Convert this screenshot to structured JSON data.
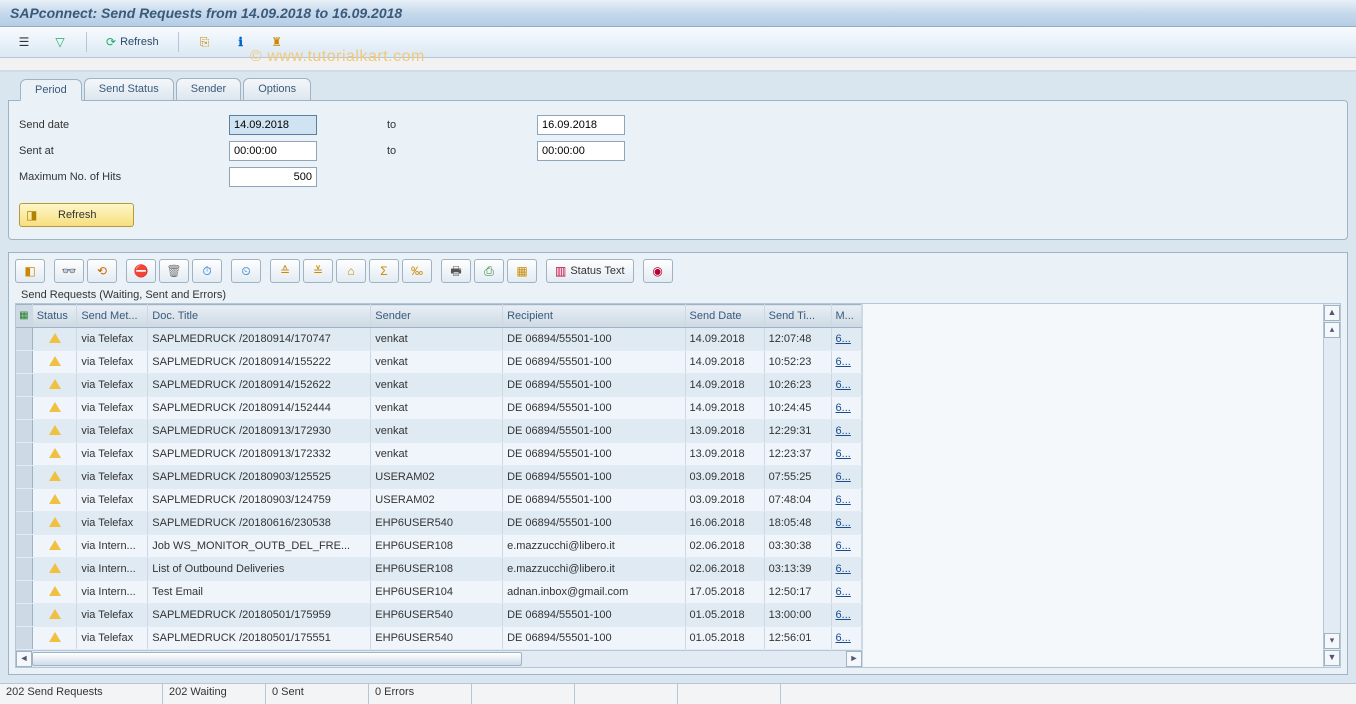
{
  "title": "SAPconnect: Send Requests from 14.09.2018 to 16.09.2018",
  "watermark": "©   www.tutorialkart.com",
  "toolbar": {
    "refresh_label": "Refresh"
  },
  "tabs": [
    "Period",
    "Send Status",
    "Sender",
    "Options"
  ],
  "form": {
    "send_date_label": "Send date",
    "send_date_from": "14.09.2018",
    "to_label": "to",
    "send_date_to": "16.09.2018",
    "sent_at_label": "Sent at",
    "sent_at_from": "00:00:00",
    "sent_at_to": "00:00:00",
    "max_hits_label": "Maximum No. of Hits",
    "max_hits": "500",
    "refresh_btn": "Refresh"
  },
  "grid_toolbar": {
    "status_text_label": "Status Text"
  },
  "grid": {
    "subtitle": "Send Requests (Waiting, Sent and Errors)",
    "columns": {
      "status": "Status",
      "method": "Send Met...",
      "title": "Doc. Title",
      "sender": "Sender",
      "recipient": "Recipient",
      "date": "Send Date",
      "time": "Send Ti...",
      "msg": "M..."
    },
    "rows": [
      {
        "method": "via Telefax",
        "title": "SAPLMEDRUCK /20180914/170747",
        "sender": "venkat",
        "recipient": "DE 06894/55501-100",
        "date": "14.09.2018",
        "time": "12:07:48",
        "msg": "6..."
      },
      {
        "method": "via Telefax",
        "title": "SAPLMEDRUCK /20180914/155222",
        "sender": "venkat",
        "recipient": "DE 06894/55501-100",
        "date": "14.09.2018",
        "time": "10:52:23",
        "msg": "6..."
      },
      {
        "method": "via Telefax",
        "title": "SAPLMEDRUCK /20180914/152622",
        "sender": "venkat",
        "recipient": "DE 06894/55501-100",
        "date": "14.09.2018",
        "time": "10:26:23",
        "msg": "6..."
      },
      {
        "method": "via Telefax",
        "title": "SAPLMEDRUCK /20180914/152444",
        "sender": "venkat",
        "recipient": "DE 06894/55501-100",
        "date": "14.09.2018",
        "time": "10:24:45",
        "msg": "6..."
      },
      {
        "method": "via Telefax",
        "title": "SAPLMEDRUCK /20180913/172930",
        "sender": "venkat",
        "recipient": "DE 06894/55501-100",
        "date": "13.09.2018",
        "time": "12:29:31",
        "msg": "6..."
      },
      {
        "method": "via Telefax",
        "title": "SAPLMEDRUCK /20180913/172332",
        "sender": "venkat",
        "recipient": "DE 06894/55501-100",
        "date": "13.09.2018",
        "time": "12:23:37",
        "msg": "6..."
      },
      {
        "method": "via Telefax",
        "title": "SAPLMEDRUCK /20180903/125525",
        "sender": "USERAM02",
        "recipient": "DE 06894/55501-100",
        "date": "03.09.2018",
        "time": "07:55:25",
        "msg": "6..."
      },
      {
        "method": "via Telefax",
        "title": "SAPLMEDRUCK /20180903/124759",
        "sender": "USERAM02",
        "recipient": "DE 06894/55501-100",
        "date": "03.09.2018",
        "time": "07:48:04",
        "msg": "6..."
      },
      {
        "method": "via Telefax",
        "title": "SAPLMEDRUCK /20180616/230538",
        "sender": "EHP6USER540",
        "recipient": "DE 06894/55501-100",
        "date": "16.06.2018",
        "time": "18:05:48",
        "msg": "6..."
      },
      {
        "method": "via Intern...",
        "title": "Job WS_MONITOR_OUTB_DEL_FRE...",
        "sender": "EHP6USER108",
        "recipient": "e.mazzucchi@libero.it",
        "date": "02.06.2018",
        "time": "03:30:38",
        "msg": "6..."
      },
      {
        "method": "via Intern...",
        "title": "List of Outbound Deliveries",
        "sender": "EHP6USER108",
        "recipient": "e.mazzucchi@libero.it",
        "date": "02.06.2018",
        "time": "03:13:39",
        "msg": "6..."
      },
      {
        "method": "via Intern...",
        "title": "Test Email",
        "sender": "EHP6USER104",
        "recipient": "adnan.inbox@gmail.com",
        "date": "17.05.2018",
        "time": "12:50:17",
        "msg": "6..."
      },
      {
        "method": "via Telefax",
        "title": "SAPLMEDRUCK /20180501/175959",
        "sender": "EHP6USER540",
        "recipient": "DE 06894/55501-100",
        "date": "01.05.2018",
        "time": "13:00:00",
        "msg": "6..."
      },
      {
        "method": "via Telefax",
        "title": "SAPLMEDRUCK /20180501/175551",
        "sender": "EHP6USER540",
        "recipient": "DE 06894/55501-100",
        "date": "01.05.2018",
        "time": "12:56:01",
        "msg": "6..."
      }
    ]
  },
  "statusbar": {
    "requests": "202 Send Requests",
    "waiting": "202 Waiting",
    "sent": "0 Sent",
    "errors": "0 Errors"
  }
}
